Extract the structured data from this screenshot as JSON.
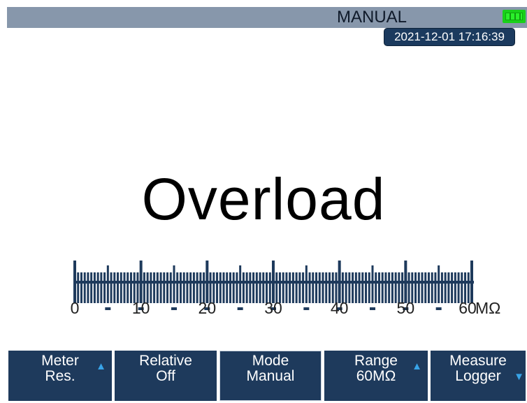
{
  "status_bar": {
    "mode": "MANUAL",
    "timestamp": "2021-12-01 17:16:39"
  },
  "reading": {
    "value": "Overload"
  },
  "scale": {
    "labels": [
      "0",
      "10",
      "20",
      "30",
      "40",
      "50",
      "60"
    ],
    "unit": "MΩ",
    "min": 0,
    "max": 60
  },
  "softkeys": [
    {
      "line1": "Meter",
      "line2": "Res.",
      "arrow": "up"
    },
    {
      "line1": "Relative",
      "line2": "Off",
      "arrow": ""
    },
    {
      "line1": "Mode",
      "line2": "Manual",
      "arrow": ""
    },
    {
      "line1": "Range",
      "line2": "60MΩ",
      "arrow": "up"
    },
    {
      "line1": "Measure",
      "line2": "Logger",
      "arrow": "down"
    }
  ],
  "colors": {
    "status_bar": "#8797ab",
    "softkey_bg": "#1e3a5c",
    "scale": "#1e3a5c",
    "battery": "#19d019",
    "arrow": "#38a4e8"
  }
}
